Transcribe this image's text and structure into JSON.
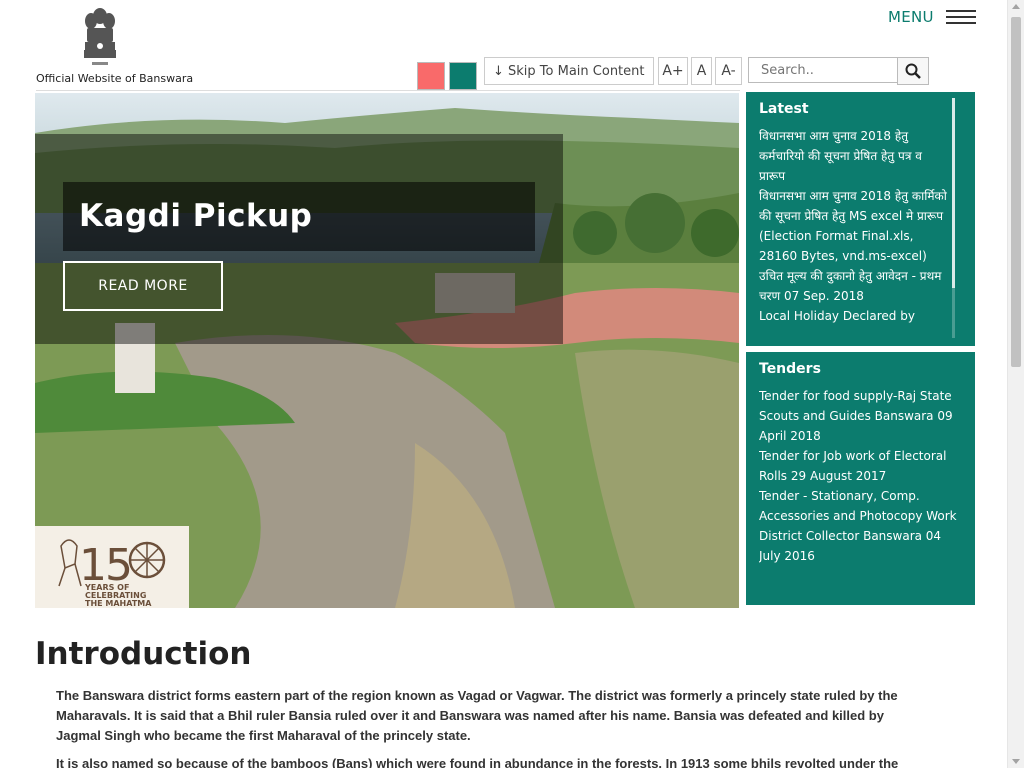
{
  "header": {
    "site_name": "Official Website of Banswara",
    "menu_label": "MENU",
    "skip_label": "↓ Skip To Main Content",
    "font_increase": "A+",
    "font_normal": "A",
    "font_decrease": "A-",
    "search_placeholder": "Search..",
    "theme_colors": {
      "red": "#f96a6a",
      "teal": "#0c7c6e"
    }
  },
  "hero": {
    "title": "Kagdi Pickup",
    "read_more": "READ MORE",
    "badge_text": "150 YEARS OF CELEBRATING THE MAHATMA"
  },
  "latest": {
    "heading": "Latest",
    "items": [
      "विधानसभा आम चुनाव 2018 हेतु कर्मचारियो की सूचना प्रेषित हेतु पत्र व प्रारूप",
      "विधानसभा आम चुनाव 2018 हेतु कार्मिको की सूचना प्रेषित हेतु MS excel मे प्रारूप (Election Format Final.xls, 28160 Bytes, vnd.ms-excel)",
      "उचित मूल्य की दुकानो हेतु आवेदन - प्रथम चरण 07 Sep. 2018",
      "Local Holiday Declared by"
    ]
  },
  "tenders": {
    "heading": "Tenders",
    "items": [
      "Tender for food supply-Raj State Scouts and Guides Banswara 09 April 2018",
      "Tender for Job work of Electoral Rolls 29 August 2017",
      "Tender - Stationary, Comp. Accessories and Photocopy Work District Collector Banswara 04 July 2016"
    ]
  },
  "intro": {
    "title": "Introduction",
    "p1": "The Banswara district forms eastern part of the region known as Vagad or Vagwar. The district was formerly a princely state ruled by the Maharavals. It is said that a Bhil ruler Bansia ruled over it and Banswara was named after his name. Bansia was defeated and killed by Jagmal Singh who became the first Maharaval of the princely state.",
    "p2": "It is also named so because of the bamboos (Bans) which were found in abundance in the forests. In 1913 some bhils revolted under the"
  },
  "colors": {
    "accent": "#0c7c6e"
  }
}
